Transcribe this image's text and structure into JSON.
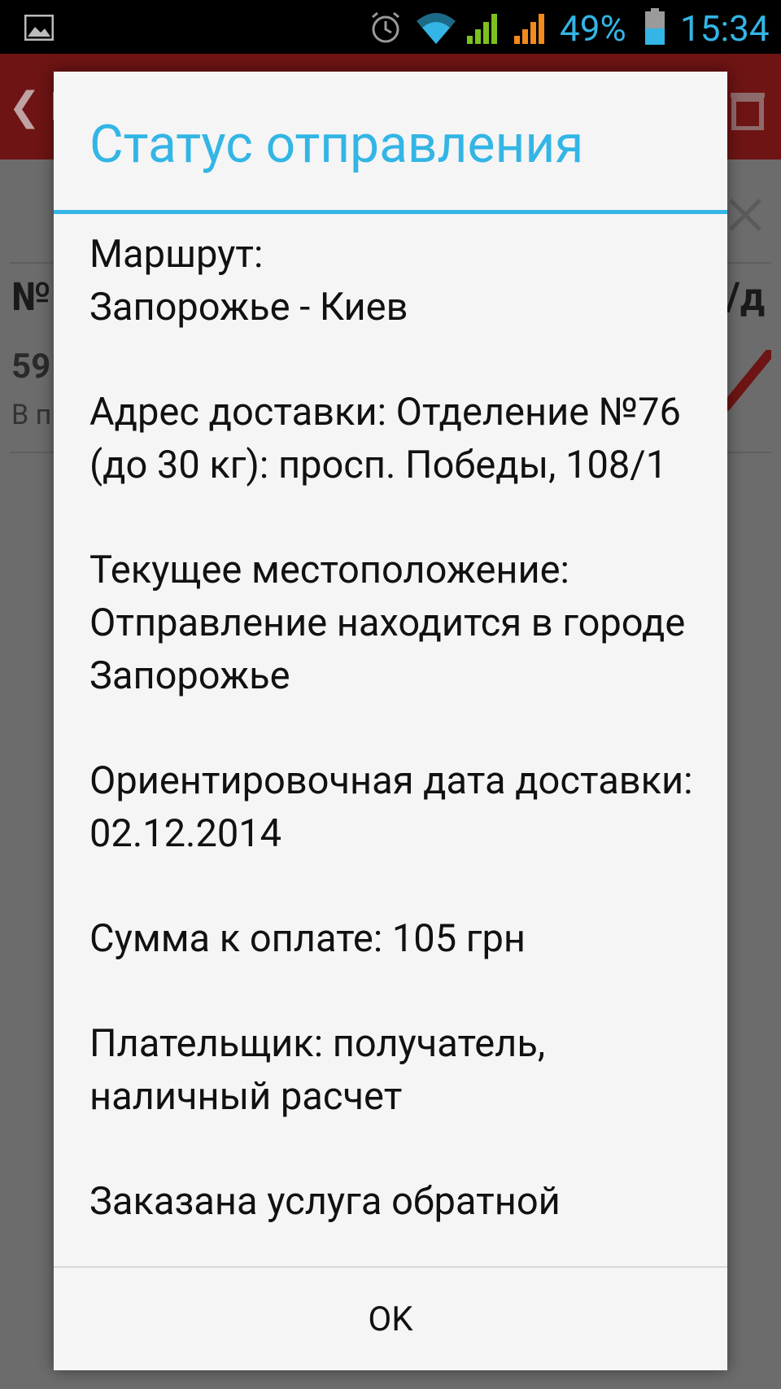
{
  "status_bar": {
    "battery_percent": "49%",
    "time": "15:34",
    "icons": [
      "gallery-icon",
      "alarm-icon",
      "wifi-icon",
      "signal-icon",
      "signal-icon",
      "battery-icon"
    ],
    "accent_color": "#33b5e5"
  },
  "background_app": {
    "back_label": "❮ P",
    "list_header_left": "№",
    "list_header_right": "/д",
    "item_number": "59",
    "item_status": "В п"
  },
  "dialog": {
    "title": "Статус отправления",
    "accent_color": "#33b5e5",
    "paragraphs": [
      "Маршрут:\nЗапорожье - Киев",
      "Адрес доставки: Отделение №76 (до 30 кг): просп. Победы, 108/1",
      "Текущее местоположение: Отправление находится в городе Запорожье",
      "Ориентировочная дата доставки: 02.12.2014",
      "Сумма к оплате: 105 грн",
      "Плательщик: получатель, наличный расчет",
      "Заказана услуга обратной"
    ],
    "ok_label": "OK"
  }
}
